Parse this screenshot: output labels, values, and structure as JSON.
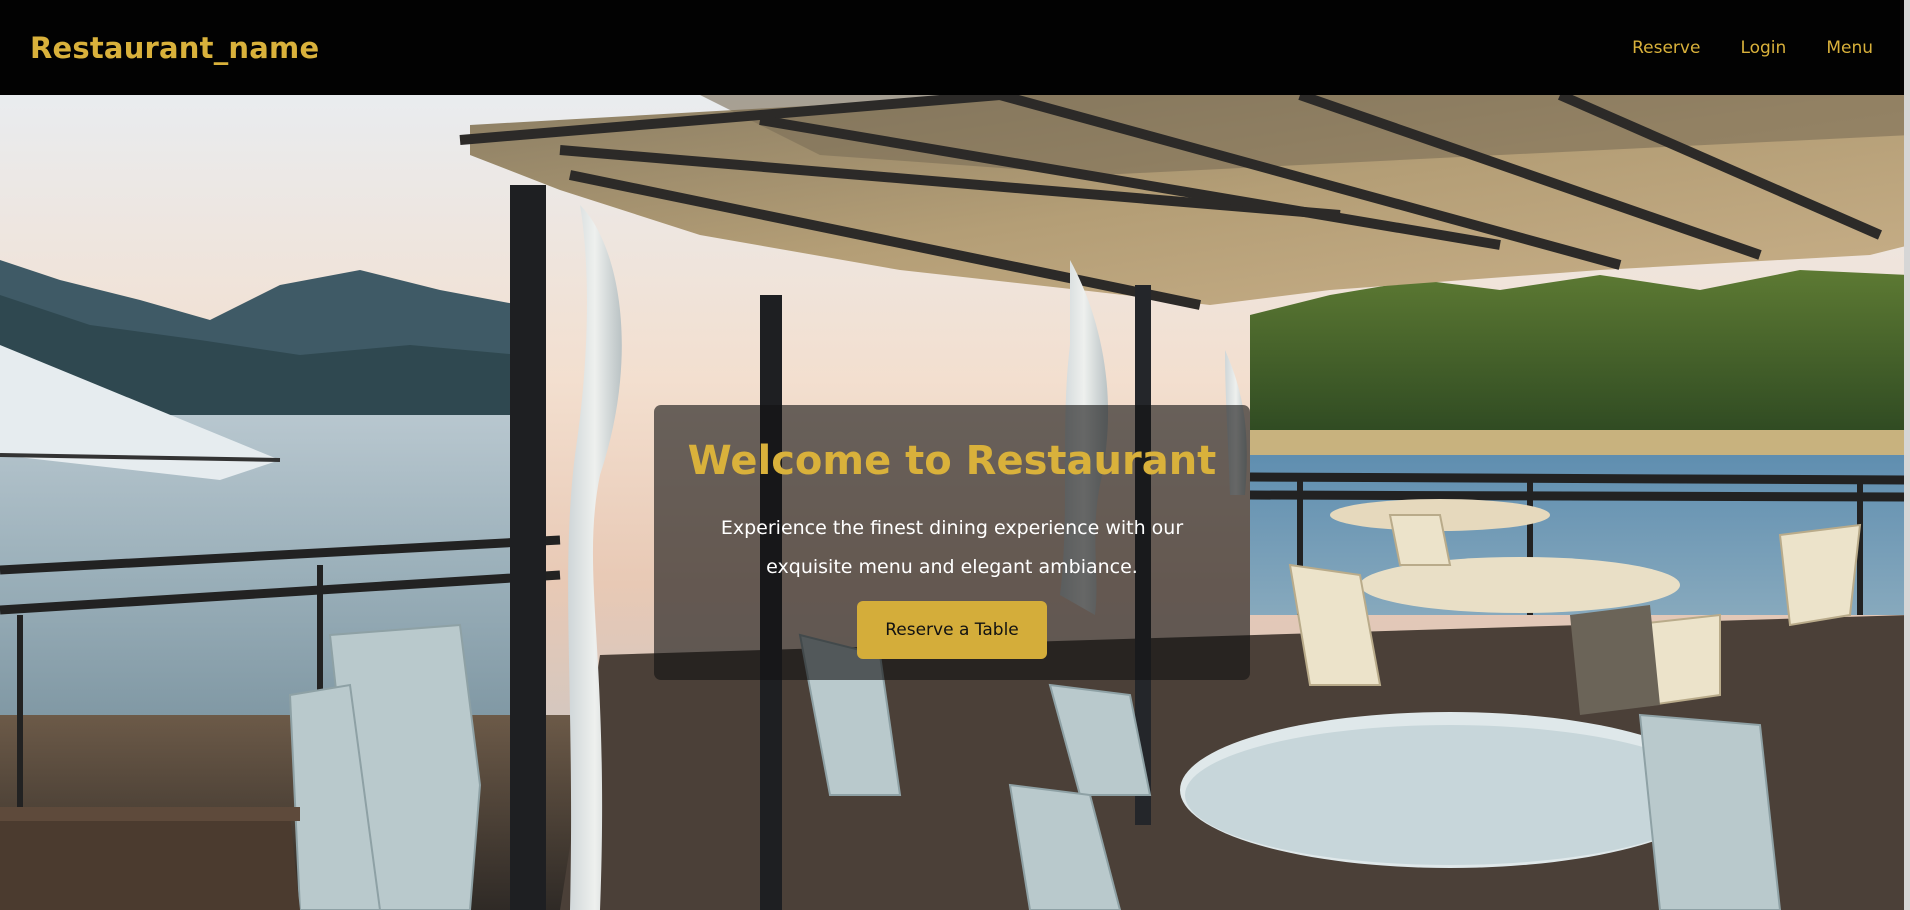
{
  "navbar": {
    "brand": "Restaurant_name",
    "links": [
      {
        "label": "Reserve"
      },
      {
        "label": "Login"
      },
      {
        "label": "Menu"
      }
    ]
  },
  "hero": {
    "title": "Welcome to Restaurant",
    "text": "Experience the finest dining experience with our exquisite menu and elegant ambiance.",
    "button_label": "Reserve a Table",
    "background_icon": "lakeside-terrace-photo"
  },
  "colors": {
    "accent": "#d9b13b",
    "navbar_bg": "#020202",
    "button_bg": "#d4ad3a",
    "card_bg": "rgba(20,20,20,0.62)"
  }
}
